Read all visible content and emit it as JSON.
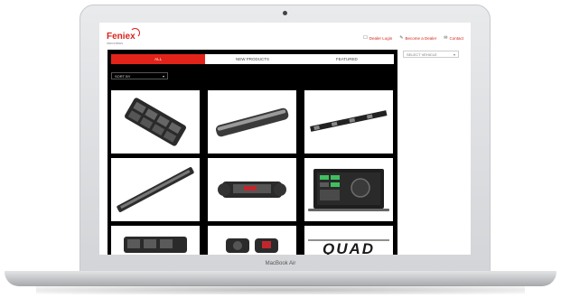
{
  "device": {
    "model_label": "MacBook Air"
  },
  "site": {
    "logo_text": "Feniex",
    "logo_tagline": "INDUSTRIES",
    "header_links": [
      {
        "glyph": "☐",
        "label": "Dealer Login"
      },
      {
        "glyph": "✎",
        "label": "Become a Dealer"
      },
      {
        "glyph": "✉",
        "label": "Contact"
      }
    ]
  },
  "content": {
    "tabs": [
      {
        "label": "ALL",
        "active": true
      },
      {
        "label": "NEW PRODUCTS",
        "active": false
      },
      {
        "label": "FEATURED",
        "active": false
      }
    ],
    "filter": {
      "value": "SORT BY",
      "chevron": "▾"
    },
    "side_select": {
      "value": "SELECT VEHICLE",
      "chevron": "▾"
    },
    "products": [
      {
        "icon": "lightbar-module-icon"
      },
      {
        "icon": "low-profile-lightbar-icon"
      },
      {
        "icon": "slim-lightbar-icon"
      },
      {
        "icon": "linear-light-stick-icon"
      },
      {
        "icon": "dash-light-icon"
      },
      {
        "icon": "controller-screen-icon"
      },
      {
        "icon": "light-module-icon"
      },
      {
        "icon": "siren-speaker-icon"
      },
      {
        "icon": "quad-logo-icon",
        "caption": "QUAD"
      }
    ]
  },
  "colors": {
    "brand_red": "#e2231a",
    "page_black": "#000000"
  }
}
